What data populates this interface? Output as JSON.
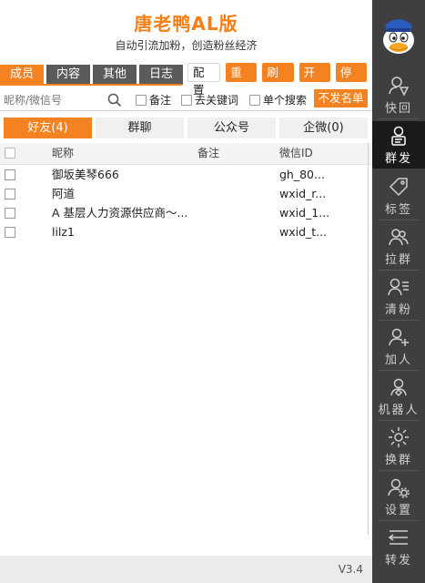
{
  "header": {
    "title": "唐老鸭AL版",
    "subtitle": "自动引流加粉，创造粉丝经济"
  },
  "category_tabs": [
    {
      "label": "成员",
      "active": true
    },
    {
      "label": "内容",
      "active": false
    },
    {
      "label": "其他",
      "active": false
    },
    {
      "label": "日志",
      "active": false
    }
  ],
  "actions": {
    "config": "配置",
    "reset": "重置",
    "refresh": "刷新",
    "start": "开始",
    "stop": "停止"
  },
  "search": {
    "placeholder": "昵称/微信号",
    "remark_label": "备注",
    "remove_keyword_label": "去关键词",
    "single_search_label": "单个搜索",
    "no_send_list": "不发名单"
  },
  "type_tabs": [
    {
      "label": "好友(4)",
      "active": true
    },
    {
      "label": "群聊",
      "active": false
    },
    {
      "label": "公众号",
      "active": false
    },
    {
      "label": "企微(0)",
      "active": false
    }
  ],
  "table": {
    "columns": {
      "nickname": "昵称",
      "remark": "备注",
      "wxid": "微信ID"
    },
    "rows": [
      {
        "nickname": "御坂美琴666",
        "remark": "",
        "wxid": "gh_80..."
      },
      {
        "nickname": "阿道",
        "remark": "",
        "wxid": "wxid_r..."
      },
      {
        "nickname": "A 基层人力资源供应商～...",
        "remark": "",
        "wxid": "wxid_1..."
      },
      {
        "nickname": "lilz1",
        "remark": "",
        "wxid": "wxid_t..."
      }
    ]
  },
  "footer": {
    "version": "V3.4"
  },
  "sidebar": {
    "avatar_icon": "donald-duck-avatar",
    "items": [
      {
        "label": "快回",
        "icon": "quick-reply-icon",
        "active": false
      },
      {
        "label": "群发",
        "icon": "mass-send-icon",
        "active": true
      },
      {
        "label": "标签",
        "icon": "tag-icon",
        "active": false
      },
      {
        "label": "拉群",
        "icon": "pull-group-icon",
        "active": false
      },
      {
        "label": "清粉",
        "icon": "clean-fans-icon",
        "active": false
      },
      {
        "label": "加人",
        "icon": "add-person-icon",
        "active": false
      },
      {
        "label": "机器人",
        "icon": "robot-icon",
        "active": false
      },
      {
        "label": "换群",
        "icon": "switch-group-icon",
        "active": false
      },
      {
        "label": "设置",
        "icon": "settings-icon",
        "active": false
      },
      {
        "label": "转发",
        "icon": "forward-icon",
        "active": false
      }
    ]
  },
  "colors": {
    "accent": "#f58220",
    "title": "#f57f17",
    "sidebar_bg": "#3f3f3f",
    "sidebar_active": "#1a1a1a"
  }
}
